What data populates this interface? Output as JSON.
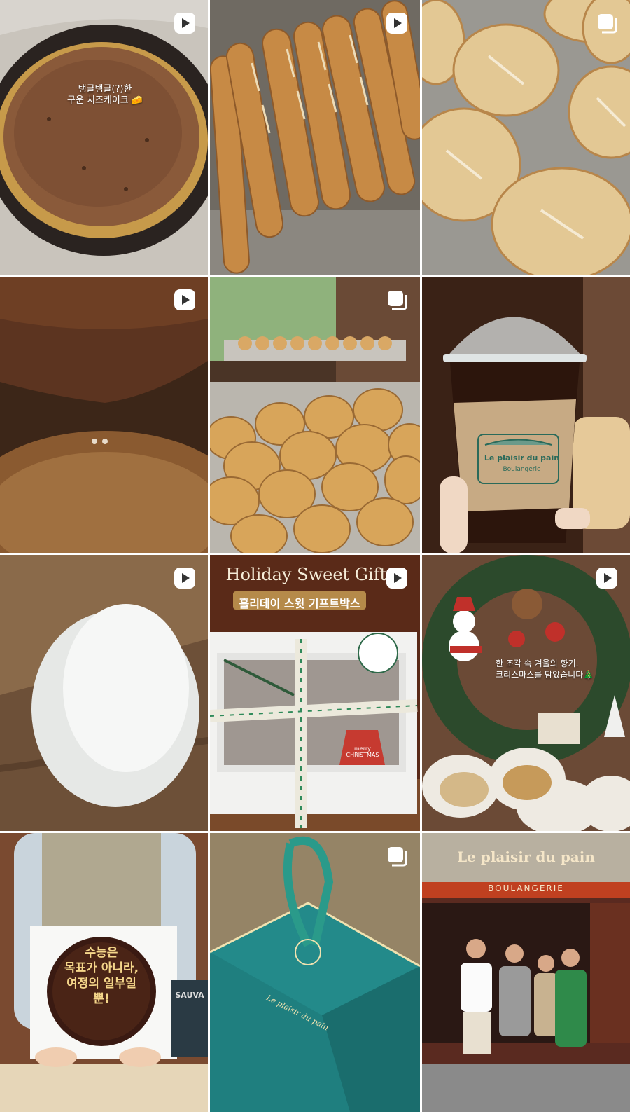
{
  "grid": {
    "posts": [
      {
        "kind": "reel",
        "icon": "reel-icon",
        "overlay_text": "탱글탱글(?)한\n구운 치즈케이크 🧀"
      },
      {
        "kind": "reel",
        "icon": "reel-icon"
      },
      {
        "kind": "carousel",
        "icon": "carousel-icon"
      },
      {
        "kind": "reel",
        "icon": "reel-icon"
      },
      {
        "kind": "carousel",
        "icon": "carousel-icon"
      },
      {
        "kind": "photo",
        "sleeve_brand": "Le plaisir du pain",
        "sleeve_sub": "Boulangerie"
      },
      {
        "kind": "reel",
        "icon": "reel-icon"
      },
      {
        "kind": "reel",
        "icon": "reel-icon",
        "title_en": "Holiday Sweet Gift B",
        "title_ko": "홀리데이 스윗 기프트박스",
        "tag_text": "merry CHRISTMAS"
      },
      {
        "kind": "reel",
        "icon": "reel-icon",
        "overlay_text": "한 조각 속 겨울의 향기.\n크리스마스를 담았습니다🎄"
      },
      {
        "kind": "photo",
        "cake_text": "수능은\n목표가 아니라,\n여정의 일부일\n뿐!",
        "bag_text": "SAUVA"
      },
      {
        "kind": "carousel",
        "icon": "carousel-icon",
        "box_text": "Le plaisir du pain"
      },
      {
        "kind": "photo",
        "sign_text": "Le plaisir du pain",
        "sign_sub": "BOULANGERIE"
      }
    ]
  },
  "colors": {
    "badge_fill": "#ffffff"
  }
}
